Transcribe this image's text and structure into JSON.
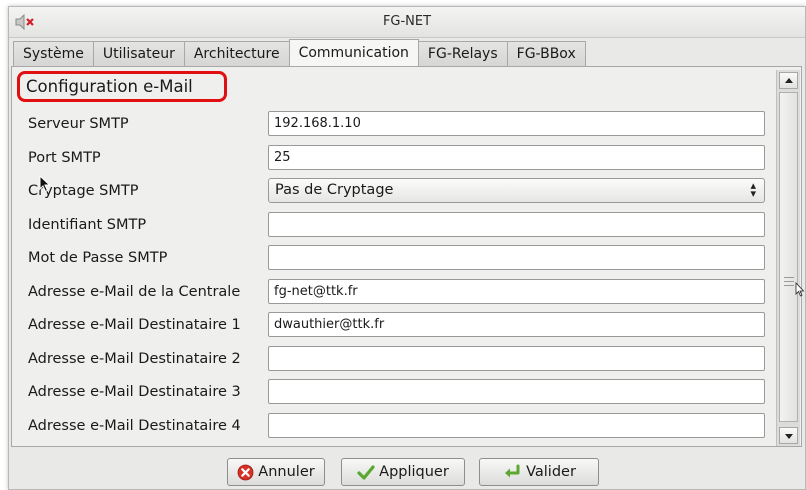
{
  "window": {
    "title": "FG-NET"
  },
  "tabs": [
    {
      "label": "Système",
      "active": false
    },
    {
      "label": "Utilisateur",
      "active": false
    },
    {
      "label": "Architecture",
      "active": false
    },
    {
      "label": "Communication",
      "active": true
    },
    {
      "label": "FG-Relays",
      "active": false
    },
    {
      "label": "FG-BBox",
      "active": false
    }
  ],
  "section": {
    "title": "Configuration e-Mail",
    "highlight_color": "#e01010"
  },
  "form": {
    "smtp_server": {
      "label": "Serveur SMTP",
      "value": "192.168.1.10"
    },
    "smtp_port": {
      "label": "Port SMTP",
      "value": "25"
    },
    "smtp_encryption": {
      "label": "Cryptage SMTP",
      "value": "Pas de Cryptage"
    },
    "smtp_login": {
      "label": "Identifiant SMTP",
      "value": ""
    },
    "smtp_password": {
      "label": "Mot de Passe SMTP",
      "value": ""
    },
    "central_email": {
      "label": "Adresse e-Mail de la Centrale",
      "value": "fg-net@ttk.fr"
    },
    "recipient_1": {
      "label": "Adresse e-Mail Destinataire 1",
      "value": "dwauthier@ttk.fr"
    },
    "recipient_2": {
      "label": "Adresse e-Mail Destinataire 2",
      "value": ""
    },
    "recipient_3": {
      "label": "Adresse e-Mail Destinataire 3",
      "value": ""
    },
    "recipient_4": {
      "label": "Adresse e-Mail Destinataire 4",
      "value": ""
    }
  },
  "buttons": {
    "cancel": {
      "label": "Annuler",
      "icon": "cancel-icon",
      "color": "#d93025"
    },
    "apply": {
      "label": "Appliquer",
      "icon": "check-icon",
      "color": "#5aa832"
    },
    "validate": {
      "label": "Valider",
      "icon": "enter-arrow-icon",
      "color": "#5aa832"
    }
  }
}
